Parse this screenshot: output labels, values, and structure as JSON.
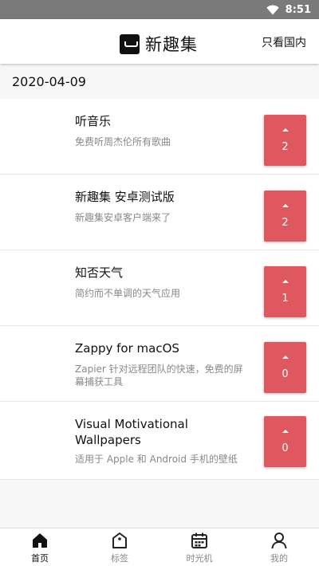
{
  "status_bar": {
    "time": "8:51"
  },
  "header": {
    "logo_text": "新趣集",
    "filter_label": "只看国内"
  },
  "feed": {
    "date": "2020-04-09",
    "items": [
      {
        "title": "听音乐",
        "description": "免费听周杰伦所有歌曲",
        "votes": "2"
      },
      {
        "title": "新趣集 安卓测试版",
        "description": "新趣集安卓客户端来了",
        "votes": "2"
      },
      {
        "title": "知否天气",
        "description": "简约而不单调的天气应用",
        "votes": "1"
      },
      {
        "title": "Zappy for macOS",
        "description": "Zapier 针对远程团队的快速，免费的屏幕捕获工具",
        "votes": "0"
      },
      {
        "title": "Visual Motivational Wallpapers",
        "description": "适用于 Apple 和 Android 手机的壁纸",
        "votes": "0"
      }
    ]
  },
  "tabs": [
    {
      "label": "首页",
      "icon": "home-icon",
      "active": true
    },
    {
      "label": "标签",
      "icon": "tag-icon",
      "active": false
    },
    {
      "label": "时光机",
      "icon": "calendar-icon",
      "active": false
    },
    {
      "label": "我的",
      "icon": "user-icon",
      "active": false
    }
  ],
  "colors": {
    "vote_button": "#e0585f",
    "status_bar": "#7a7a7a",
    "background": "#f7f7f7"
  }
}
